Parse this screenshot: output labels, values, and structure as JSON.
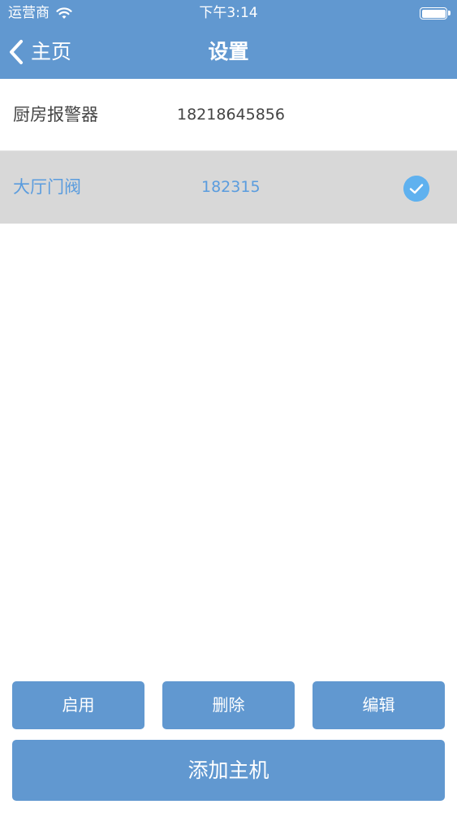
{
  "status_bar": {
    "carrier": "运营商",
    "time": "下午3:14",
    "wifi_icon": "wifi-icon",
    "battery_icon": "battery-icon"
  },
  "navbar": {
    "back_label": "主页",
    "title": "设置",
    "back_icon": "chevron-left-icon"
  },
  "devices": [
    {
      "name": "厨房报警器",
      "phone": "18218645856",
      "selected": false
    },
    {
      "name": "大厅门阀",
      "phone": "182315",
      "selected": true
    }
  ],
  "actions": {
    "enable_label": "启用",
    "delete_label": "删除",
    "edit_label": "编辑",
    "add_label": "添加主机"
  },
  "colors": {
    "header": "#6198d0",
    "button": "#6198d0",
    "selected_row": "#d8d8d8",
    "selected_text": "#5a9cde",
    "check": "#5fb1ef"
  }
}
